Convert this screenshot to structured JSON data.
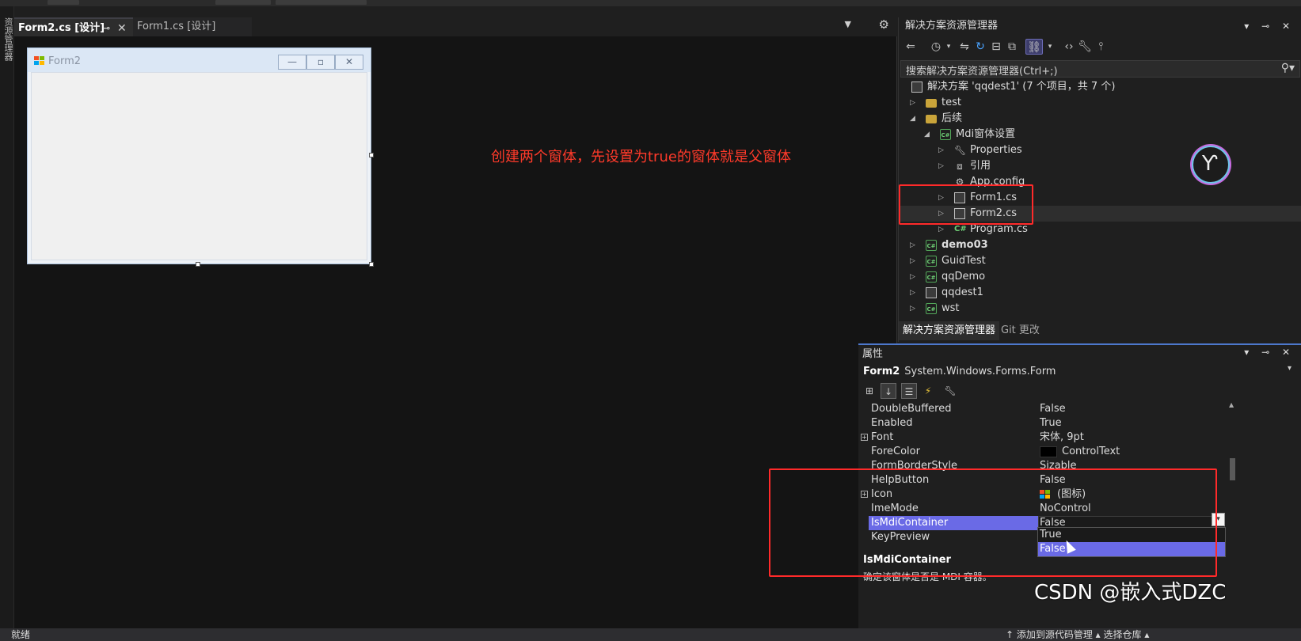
{
  "colors": {
    "accent_select": "#6a6ae6",
    "annotation_red": "#ff2a2a",
    "background": "#1f1f1f"
  },
  "left_bar": {
    "text": "资源管理器"
  },
  "doc_tabs": [
    {
      "label": "Form2.cs [设计]",
      "pin_icon": "pin-icon",
      "close_icon": "close-icon"
    },
    {
      "label": "Form1.cs [设计]"
    }
  ],
  "designer": {
    "form_title": "Form2",
    "annotation": "创建两个窗体，先设置为true的窗体就是父窗体"
  },
  "solution_explorer": {
    "title": "解决方案资源管理器",
    "search_placeholder": "搜索解决方案资源管理器(Ctrl+;)",
    "tree": [
      {
        "label": "解决方案 'qqdest1' (7 个项目，共 7 个)",
        "icon": "solution-icon",
        "indent": 0,
        "arrow": "",
        "bold": false
      },
      {
        "label": "test",
        "icon": "folder-icon",
        "indent": 1,
        "arrow": "▷",
        "bold": false
      },
      {
        "label": "后续",
        "icon": "folder-icon",
        "indent": 1,
        "arrow": "◢",
        "bold": false
      },
      {
        "label": "Mdi窗体设置",
        "icon": "csharp-project-icon",
        "indent": 2,
        "arrow": "◢",
        "bold": false
      },
      {
        "label": "Properties",
        "icon": "wrench-icon",
        "indent": 3,
        "arrow": "▷",
        "bold": false
      },
      {
        "label": "引用",
        "icon": "references-icon",
        "indent": 3,
        "arrow": "▷",
        "bold": false
      },
      {
        "label": "App.config",
        "icon": "config-icon",
        "indent": 3,
        "arrow": "",
        "bold": false
      },
      {
        "label": "Form1.cs",
        "icon": "form-icon",
        "indent": 3,
        "arrow": "▷",
        "bold": false
      },
      {
        "label": "Form2.cs",
        "icon": "form-icon",
        "indent": 3,
        "arrow": "▷",
        "bold": false,
        "selected": true
      },
      {
        "label": "Program.cs",
        "icon": "csharp-file-icon",
        "indent": 3,
        "arrow": "▷",
        "bold": false
      },
      {
        "label": "demo03",
        "icon": "csharp-project-icon",
        "indent": 1,
        "arrow": "▷",
        "bold": true
      },
      {
        "label": "GuidTest",
        "icon": "csharp-project-icon",
        "indent": 1,
        "arrow": "▷",
        "bold": false
      },
      {
        "label": "qqDemo",
        "icon": "csharp-project-icon",
        "indent": 1,
        "arrow": "▷",
        "bold": false
      },
      {
        "label": "qqdest1",
        "icon": "project-icon",
        "indent": 1,
        "arrow": "▷",
        "bold": false
      },
      {
        "label": "wst",
        "icon": "csharp-project-icon",
        "indent": 1,
        "arrow": "▷",
        "bold": false
      }
    ],
    "tabs": [
      "解决方案资源管理器",
      "Git 更改"
    ]
  },
  "properties": {
    "title": "属性",
    "object_name": "Form2",
    "object_type": "System.Windows.Forms.Form",
    "rows": [
      {
        "name": "DoubleBuffered",
        "value": "False"
      },
      {
        "name": "Enabled",
        "value": "True"
      },
      {
        "name": "Font",
        "value": "宋体, 9pt",
        "expandable": true
      },
      {
        "name": "ForeColor",
        "value": "ControlText",
        "swatch": "color"
      },
      {
        "name": "FormBorderStyle",
        "value": "Sizable"
      },
      {
        "name": "HelpButton",
        "value": "False"
      },
      {
        "name": "Icon",
        "value": "(图标)",
        "expandable": true,
        "swatch": "icon"
      },
      {
        "name": "ImeMode",
        "value": "NoControl"
      },
      {
        "name": "IsMdiContainer",
        "value": "False",
        "selected": true
      },
      {
        "name": "KeyPreview",
        "value": ""
      }
    ],
    "dropdown_options": [
      "True",
      "False"
    ],
    "dropdown_highlight": "False",
    "desc_title": "IsMdiContainer",
    "desc_text": "确定该窗体是否是 MDI 容器。"
  },
  "watermark": "CSDN @嵌入式DZC",
  "status": {
    "left": "就绪",
    "right": "↑ 添加到源代码管理 ▴  选择仓库 ▴"
  }
}
